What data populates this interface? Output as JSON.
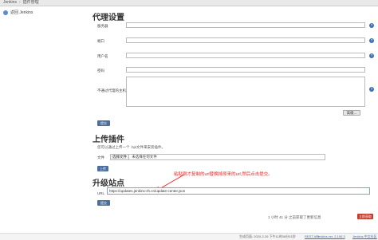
{
  "breadcrumb": {
    "home": "Jenkins",
    "separator": "›",
    "current": "插件管理"
  },
  "sidebar": {
    "items": [
      {
        "label": "返回 Jenkins",
        "icon": "up-arrow-icon"
      }
    ]
  },
  "proxy": {
    "title": "代理设置",
    "server_label": "服务器",
    "port_label": "端口",
    "user_label": "用户名",
    "password_label": "密码",
    "no_proxy_label": "不通过代理的主机",
    "advanced_button": "高级...",
    "submit_button": "提交"
  },
  "upload": {
    "title": "上传插件",
    "description": "您可以通过上传一个 .hpi文件来安装插件。",
    "file_label": "文件",
    "choose_button": "选择文件",
    "no_file_text": "未选择任何文件",
    "upload_button": "上传"
  },
  "site": {
    "title": "升级站点",
    "annotation": "粘贴刚才复制的url替换掉原来的url,然后点击提交。",
    "url_label": "URL",
    "url_value": "https://updates.jenkins-zh.cn/update-center.json",
    "submit_button": "提交"
  },
  "status": {
    "update_info": "1 小时 41 分 之前获取了更新信息",
    "check_now_button": "立即获取"
  },
  "footer": {
    "generated": "生成页面: 2020-2-26 下午11时08分01秒",
    "rest_api": "REST API",
    "version": "Jenkins ver. 2.190.3",
    "locale": "Jenkins 中文社区"
  }
}
